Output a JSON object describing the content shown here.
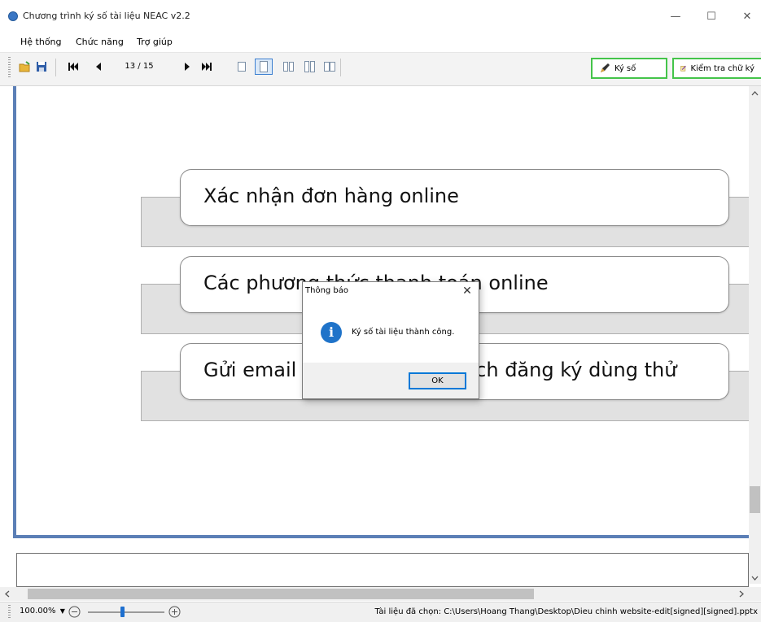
{
  "window": {
    "title": "Chương trình ký số tài liệu NEAC v2.2",
    "controls": {
      "minimize": "—",
      "maximize": "☐",
      "close": "✕"
    }
  },
  "menu": [
    "Hệ thống",
    "Chức năng",
    "Trợ giúp"
  ],
  "toolbar": {
    "page_indicator": "13 / 15",
    "sign_label": "Ký số",
    "verify_label": "Kiểm tra chữ ký"
  },
  "document": {
    "items": [
      "Xác nhận đơn hàng online",
      "Các phương thức thanh toán online",
      "Gửi email xác nhận cho khách đăng ký dùng thử"
    ]
  },
  "dialog": {
    "title": "Thông báo",
    "message": "Ký số tài liệu thành công.",
    "ok_label": "OK",
    "info_glyph": "i"
  },
  "status": {
    "zoom": "100.00%",
    "zoom_fraction": 0.45,
    "selected_doc": "Tài liệu đã chọn: C:\\Users\\Hoang Thang\\Desktop\\Dieu chinh website-edit[signed][signed].pptx"
  },
  "colors": {
    "accent_green": "#44c44a",
    "accent_blue": "#0078d7",
    "frame_blue": "#5b7fb6"
  }
}
